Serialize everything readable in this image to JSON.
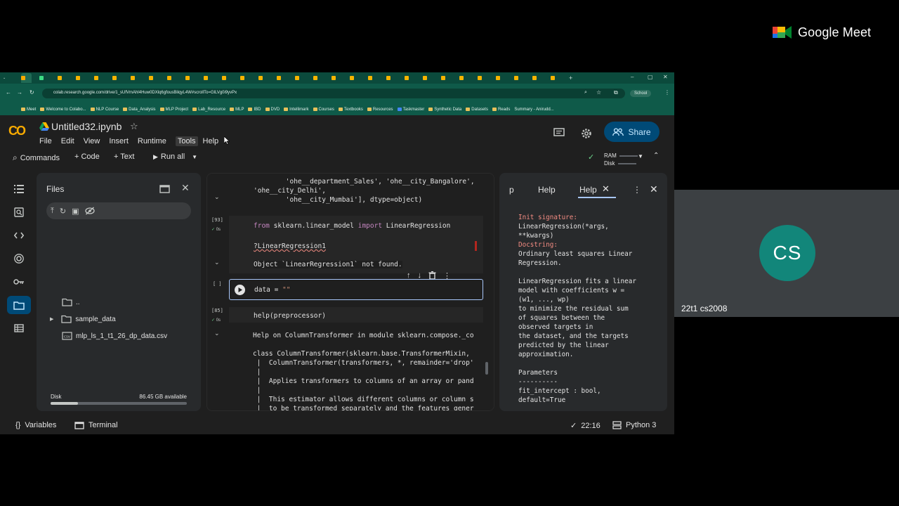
{
  "meet": {
    "brand": "Google Meet",
    "participant_initials": "CS",
    "participant_name": "22t1 cs2008",
    "avatar_color": "#12867a"
  },
  "browser": {
    "url": "colab.research.google.com/drive/1_sUfVmAhl4Huw0DXlq6gfousBilqyL4W#scrollTo=GlLVg0i9yvPx",
    "profile": "School",
    "bookmarks": [
      "Meet",
      "Welcome to Colabo...",
      "NLP Course",
      "Data_Analysis",
      "MLP Project",
      "Lab_Resource",
      "MLP",
      "IBD",
      "DVD",
      "Intellimark",
      "Courses",
      "Textbooks",
      "Resources",
      "Taskmaster",
      "Synthetic Data",
      "Datasets",
      "Reads",
      "Summary - Anirudd..."
    ]
  },
  "colab": {
    "logo": "CO",
    "title": "Untitled32.ipynb",
    "menu": [
      "File",
      "Edit",
      "View",
      "Insert",
      "Runtime",
      "Tools",
      "Help"
    ],
    "share": "Share",
    "toolbar": {
      "commands": "Commands",
      "code": "+ Code",
      "text": "+ Text",
      "run_all": "Run all",
      "ram": "RAM",
      "disk": "Disk"
    }
  },
  "files": {
    "title": "Files",
    "items": [
      {
        "name": "..",
        "type": "folder"
      },
      {
        "name": "sample_data",
        "type": "folder"
      },
      {
        "name": "mlp_ls_1_t1_26_dp_data.csv",
        "type": "csv"
      }
    ],
    "disk_label": "Disk",
    "disk_available": "86.45 GB available",
    "disk_used_fraction": 0.2
  },
  "notebook": {
    "out1": [
      "        'ohe__department_Sales', 'ohe__city_Bangalore',",
      "'ohe__city_Delhi',",
      "        'ohe__city_Mumbai'], dtype=object)"
    ],
    "cell2": {
      "exec": "[93]",
      "time": "0s",
      "line1_kw1": "from",
      "line1_mod": " sklearn.linear_model ",
      "line1_kw2": "import",
      "line1_name": " LinearRegression",
      "line2": "?LinearRegression1",
      "output": "Object `LinearRegression1` not found."
    },
    "cell3": {
      "exec": "[ ]",
      "code_pre": "data = ",
      "code_str": "\"\""
    },
    "cell4": {
      "exec": "[85]",
      "time": "0s",
      "code": "help(preprocessor)",
      "output": [
        "Help on ColumnTransformer in module sklearn.compose._co",
        "",
        "class ColumnTransformer(sklearn.base.TransformerMixin,",
        " |  ColumnTransformer(transformers, *, remainder='drop'",
        " |",
        " |  Applies transformers to columns of an array or pand",
        " |",
        " |  This estimator allows different columns or column s",
        " |  to be transformed separately and the features gener"
      ]
    }
  },
  "help": {
    "tabs": [
      "p",
      "Help",
      "Help"
    ],
    "sig_label": "Init signature:",
    "sig": "LinearRegression(*args,\n**kwargs)",
    "doc_label": "Docstring:",
    "doc": "Ordinary least squares Linear\nRegression.\n\nLinearRegression fits a linear\nmodel with coefficients w =\n(w1, ..., wp)\nto minimize the residual sum\nof squares between the\nobserved targets in\nthe dataset, and the targets\npredicted by the linear\napproximation.\n\nParameters\n----------\nfit_intercept : bool,\ndefault=True"
  },
  "status": {
    "variables": "Variables",
    "terminal": "Terminal",
    "time": "22:16",
    "kernel": "Python 3"
  }
}
